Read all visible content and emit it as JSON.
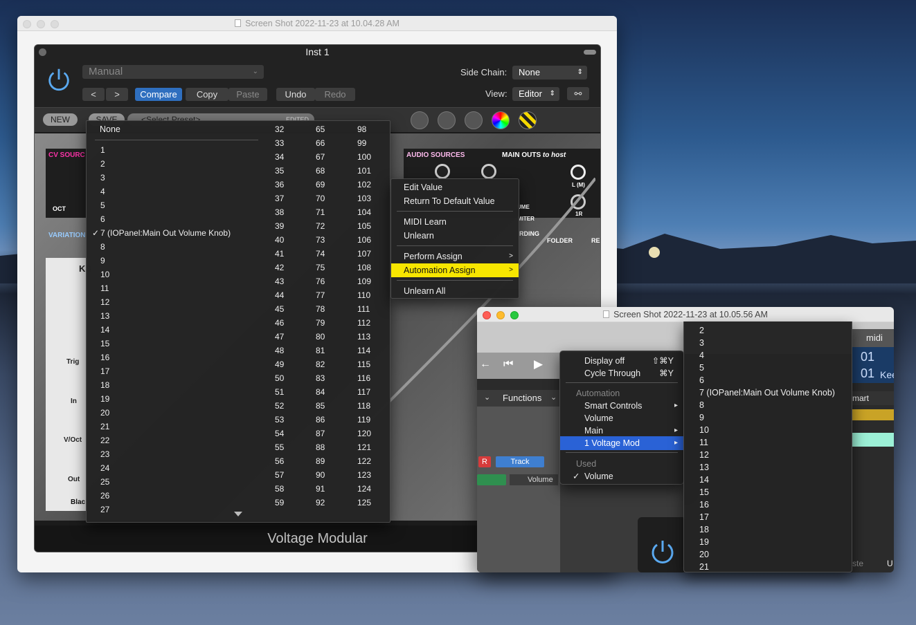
{
  "window1": {
    "title": "Screen Shot 2022-11-23 at 10.04.28 AM",
    "plugin": {
      "title": "Inst 1",
      "preset": "Manual",
      "side_chain_label": "Side Chain:",
      "side_chain_value": "None",
      "view_label": "View:",
      "view_value": "Editor",
      "buttons": {
        "compare": "Compare",
        "copy": "Copy",
        "paste": "Paste",
        "undo": "Undo",
        "redo": "Redo"
      },
      "new_label": "NEW",
      "save_label": "SAVE",
      "select_preset": "<Select Preset>",
      "edited": "EDITED",
      "modules": {
        "cv_sources": "CV SOURC",
        "audio_sources": "AUDIO SOURCES",
        "main_outs": "MAIN OUTS",
        "main_outs_sub": "to host",
        "variation": "VARIATION",
        "oct": "OCT",
        "folder": "FOLDER",
        "re": "RE",
        "rding": "RDING",
        "l_m": "L (M)",
        "r": "1R",
        "ume": "UME",
        "miter": "MITER",
        "ks": "KS",
        "jacks": [
          "Trig",
          "In",
          "V/Oct",
          "Out"
        ],
        "blac": "Blac"
      },
      "footer": "Voltage Modular"
    },
    "number_menu": {
      "none": "None",
      "col1": [
        "1",
        "2",
        "3",
        "4",
        "5",
        "6",
        "7 (IOPanel:Main Out Volume Knob)",
        "8",
        "9",
        "10",
        "11",
        "12",
        "13",
        "14",
        "15",
        "16",
        "17",
        "18",
        "19",
        "20",
        "21",
        "22",
        "23",
        "24",
        "25",
        "26",
        "27"
      ],
      "checked_index": 6,
      "col2": [
        "32",
        "33",
        "34",
        "35",
        "36",
        "37",
        "38",
        "39",
        "40",
        "41",
        "42",
        "43",
        "44",
        "45",
        "46",
        "47",
        "48",
        "49",
        "50",
        "51",
        "52",
        "53",
        "54",
        "55",
        "56",
        "57",
        "58",
        "59"
      ],
      "col3": [
        "65",
        "66",
        "67",
        "68",
        "69",
        "70",
        "71",
        "72",
        "73",
        "74",
        "75",
        "76",
        "77",
        "78",
        "79",
        "80",
        "81",
        "82",
        "83",
        "84",
        "85",
        "86",
        "87",
        "88",
        "89",
        "90",
        "91",
        "92"
      ],
      "col4": [
        "98",
        "99",
        "100",
        "101",
        "102",
        "103",
        "104",
        "105",
        "106",
        "107",
        "108",
        "109",
        "110",
        "111",
        "112",
        "113",
        "114",
        "115",
        "116",
        "117",
        "118",
        "119",
        "120",
        "121",
        "122",
        "123",
        "124",
        "125"
      ]
    },
    "context_menu": {
      "items": [
        "Edit Value",
        "Return To Default Value",
        "MIDI Learn",
        "Unlearn",
        "Perform Assign",
        "Automation Assign",
        "Unlearn All"
      ]
    }
  },
  "window2": {
    "title": "Screen Shot 2022-11-23 at 10.05.56 AM",
    "functions_label": "Functions",
    "track_label": "Track",
    "volume_label": "Volume",
    "r_label": "R",
    "midi_label": "midi",
    "art_label": "mart",
    "kee_label": "Kee",
    "digits": [
      "01",
      "01"
    ],
    "ste": "ste",
    "u": "U",
    "menu": {
      "display_off": "Display off",
      "display_off_sc": "⇧⌘Y",
      "cycle_through": "Cycle Through",
      "cycle_through_sc": "⌘Y",
      "automation_header": "Automation",
      "smart_controls": "Smart Controls",
      "volume": "Volume",
      "main": "Main",
      "voltage_mod": "1 Voltage Mod",
      "used_header": "Used",
      "used_volume": "Volume"
    },
    "submenu": [
      "2",
      "3",
      "4",
      "5",
      "6",
      "7 (IOPanel:Main Out Volume Knob)",
      "8",
      "9",
      "10",
      "11",
      "12",
      "13",
      "14",
      "15",
      "16",
      "17",
      "18",
      "19",
      "20",
      "21"
    ]
  },
  "colors": {
    "yellow_highlight": "#f7e600",
    "blue_highlight": "#2a62d6",
    "compare_blue": "#2f6fbf"
  }
}
